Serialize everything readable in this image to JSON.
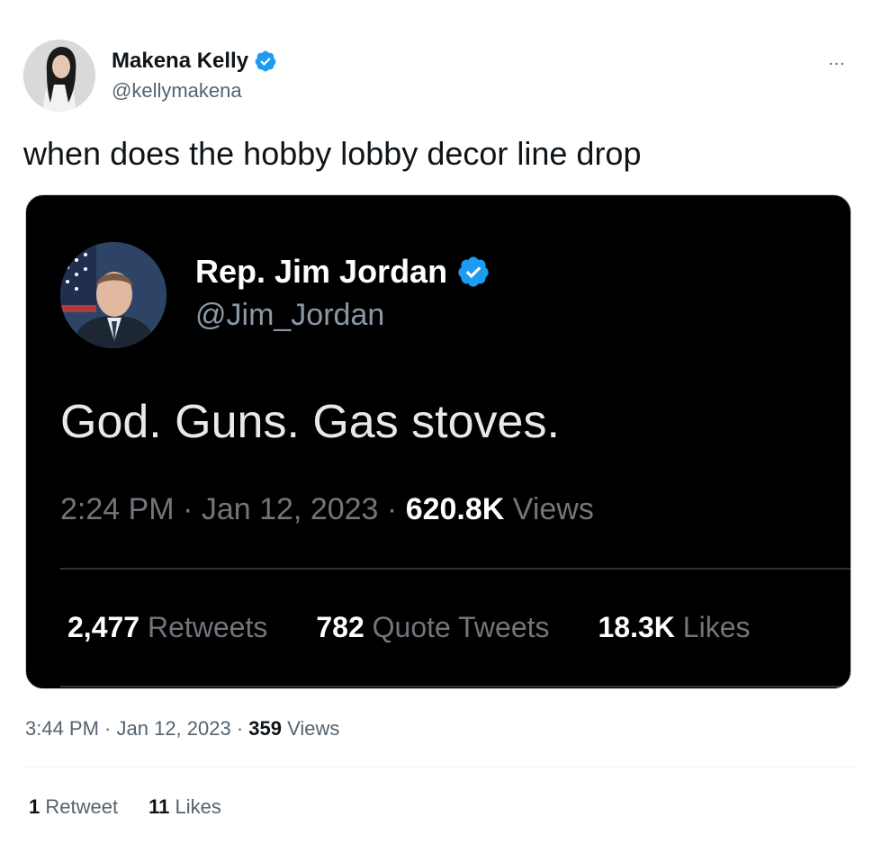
{
  "tweet": {
    "author": {
      "name": "Makena Kelly",
      "handle": "@kellymakena",
      "verified": true
    },
    "text": "when does the hobby lobby decor line drop",
    "more_icon": "…",
    "meta": {
      "time": "3:44 PM",
      "sep1": " · ",
      "date": "Jan 12, 2023",
      "sep2": " · ",
      "views_count": "359",
      "views_label": " Views"
    },
    "stats": {
      "retweets_count": "1",
      "retweets_label": " Retweet",
      "likes_count": "11",
      "likes_label": " Likes"
    }
  },
  "embedded_tweet": {
    "author": {
      "name": "Rep. Jim Jordan",
      "handle": "@Jim_Jordan",
      "verified": true
    },
    "text": "God. Guns. Gas stoves.",
    "meta": {
      "time": "2:24 PM",
      "sep1": " · ",
      "date": "Jan 12, 2023",
      "sep2": " · ",
      "views_count": "620.8K",
      "views_label": " Views"
    },
    "stats": {
      "retweets_count": "2,477",
      "retweets_label": " Retweets",
      "quotes_count": "782",
      "quotes_label": " Quote Tweets",
      "likes_count": "18.3K",
      "likes_label": " Likes"
    }
  },
  "colors": {
    "verified_blue": "#1d9bf0",
    "text_primary": "#0f1419",
    "text_secondary": "#536471",
    "embed_bg": "#000000"
  },
  "icons": {
    "verified": "verified-badge-icon",
    "more": "more-horizontal-icon"
  }
}
